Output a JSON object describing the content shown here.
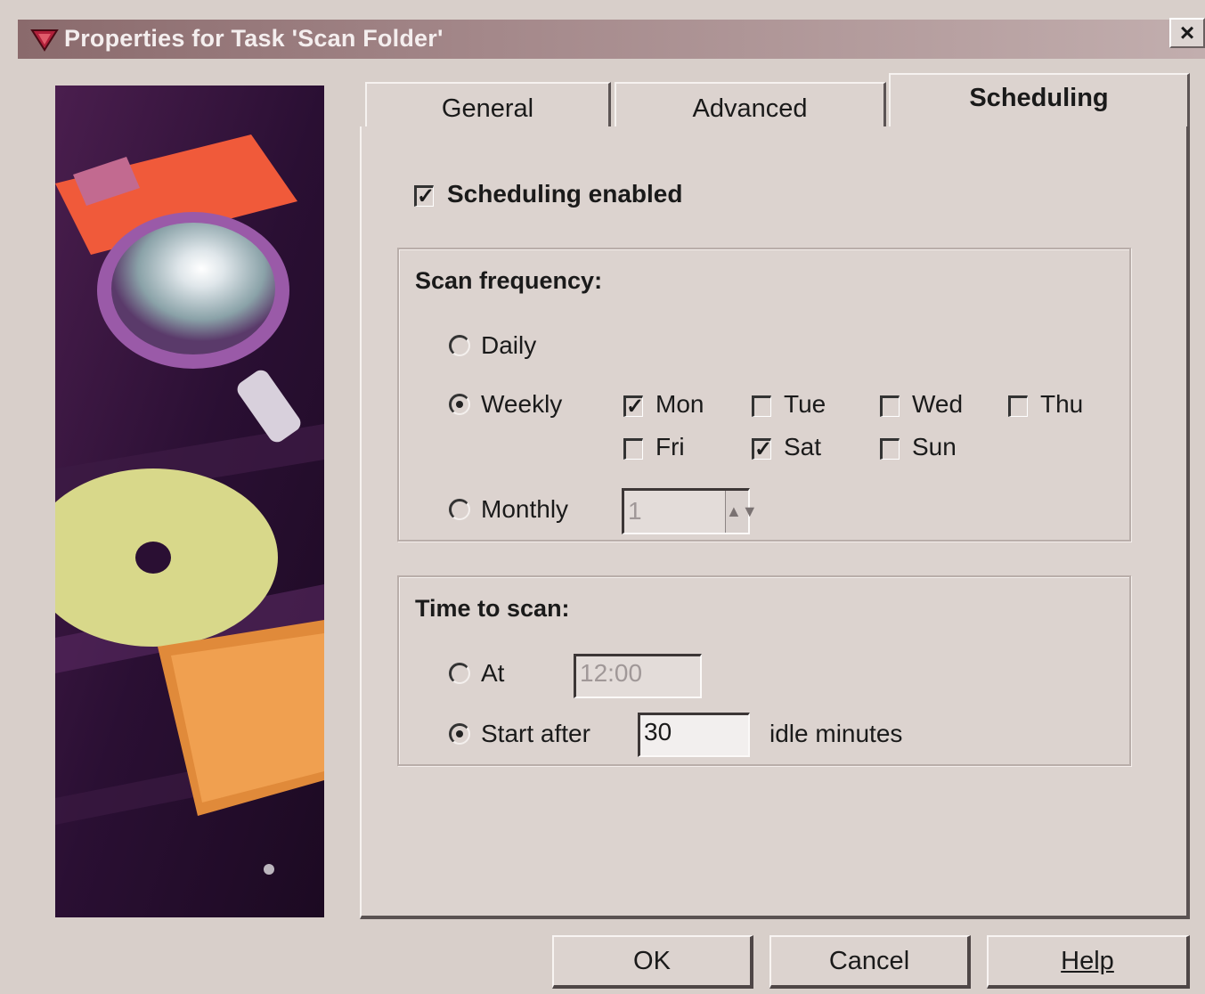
{
  "window": {
    "title": "Properties for Task 'Scan Folder'",
    "close_label": "×"
  },
  "tabs": [
    {
      "label": "General",
      "active": false
    },
    {
      "label": "Advanced",
      "active": false
    },
    {
      "label": "Scheduling",
      "active": true
    }
  ],
  "scheduling": {
    "enabled_label": "Scheduling enabled",
    "enabled": true,
    "frequency": {
      "title": "Scan frequency:",
      "daily_label": "Daily",
      "weekly_label": "Weekly",
      "monthly_label": "Monthly",
      "selected": "Weekly",
      "days": [
        {
          "label": "Mon",
          "checked": true
        },
        {
          "label": "Tue",
          "checked": false
        },
        {
          "label": "Wed",
          "checked": false
        },
        {
          "label": "Thu",
          "checked": false
        },
        {
          "label": "Fri",
          "checked": false
        },
        {
          "label": "Sat",
          "checked": true
        },
        {
          "label": "Sun",
          "checked": false
        }
      ],
      "monthly_value": "1"
    },
    "time": {
      "title": "Time to scan:",
      "at_label": "At",
      "at_value": "12:00",
      "start_after_label": "Start after",
      "start_after_value": "30",
      "idle_minutes_label": "idle minutes",
      "selected": "Start after"
    }
  },
  "buttons": {
    "ok": "OK",
    "cancel": "Cancel",
    "help": "Help"
  },
  "colors": {
    "dialog_face": "#dcd3cf",
    "title_bar": "#8a6a6c"
  }
}
